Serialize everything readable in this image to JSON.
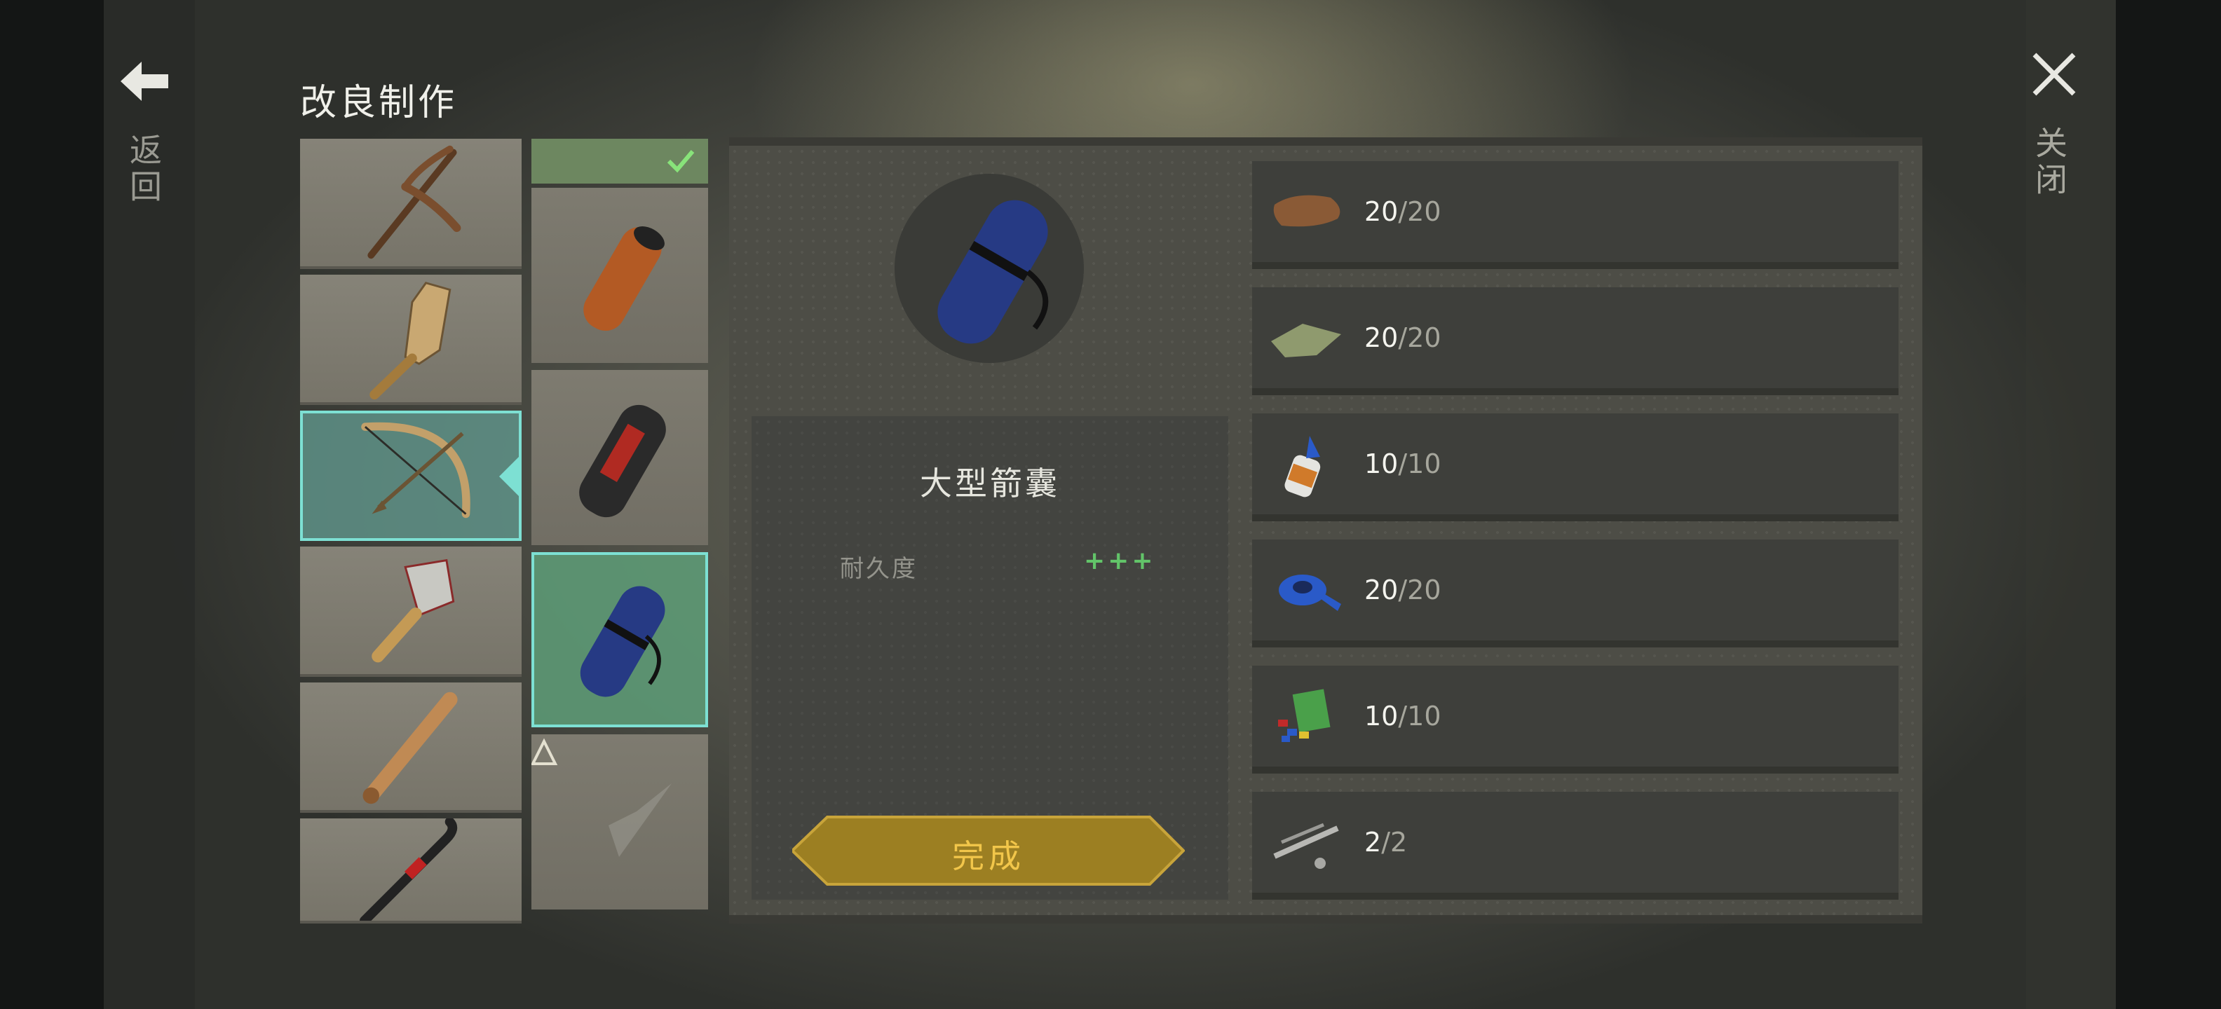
{
  "header": {
    "title": "改良制作",
    "back_label": "返回",
    "close_label": "关闭"
  },
  "weapons": [
    {
      "name": "pickaxe-icon"
    },
    {
      "name": "wooden-paddle-icon"
    },
    {
      "name": "bow-icon",
      "selected": true
    },
    {
      "name": "cleaver-icon"
    },
    {
      "name": "baseball-bat-icon"
    },
    {
      "name": "crowbar-icon"
    }
  ],
  "variants": [
    {
      "name": "leather-quiver-icon"
    },
    {
      "name": "red-quiver-icon"
    },
    {
      "name": "large-quiver-icon",
      "selected": true
    },
    {
      "name": "locked-arrowhead-icon",
      "locked": true
    }
  ],
  "detail": {
    "item_name": "大型箭囊",
    "stat_label": "耐久度",
    "stat_value": "+++",
    "complete_label": "完成"
  },
  "materials": [
    {
      "icon": "leather-icon",
      "have": "20",
      "sep": "/",
      "need": "20"
    },
    {
      "icon": "cloth-icon",
      "have": "20",
      "sep": "/",
      "need": "20"
    },
    {
      "icon": "glue-icon",
      "have": "10",
      "sep": "/",
      "need": "10"
    },
    {
      "icon": "tape-icon",
      "have": "20",
      "sep": "/",
      "need": "20"
    },
    {
      "icon": "plastic-parts-icon",
      "have": "10",
      "sep": "/",
      "need": "10"
    },
    {
      "icon": "metal-parts-icon",
      "have": "2",
      "sep": "/",
      "need": "2"
    }
  ],
  "colors": {
    "accent": "#7de0d3",
    "button_gold": "#9c7f22",
    "stat_green": "#62c469"
  }
}
